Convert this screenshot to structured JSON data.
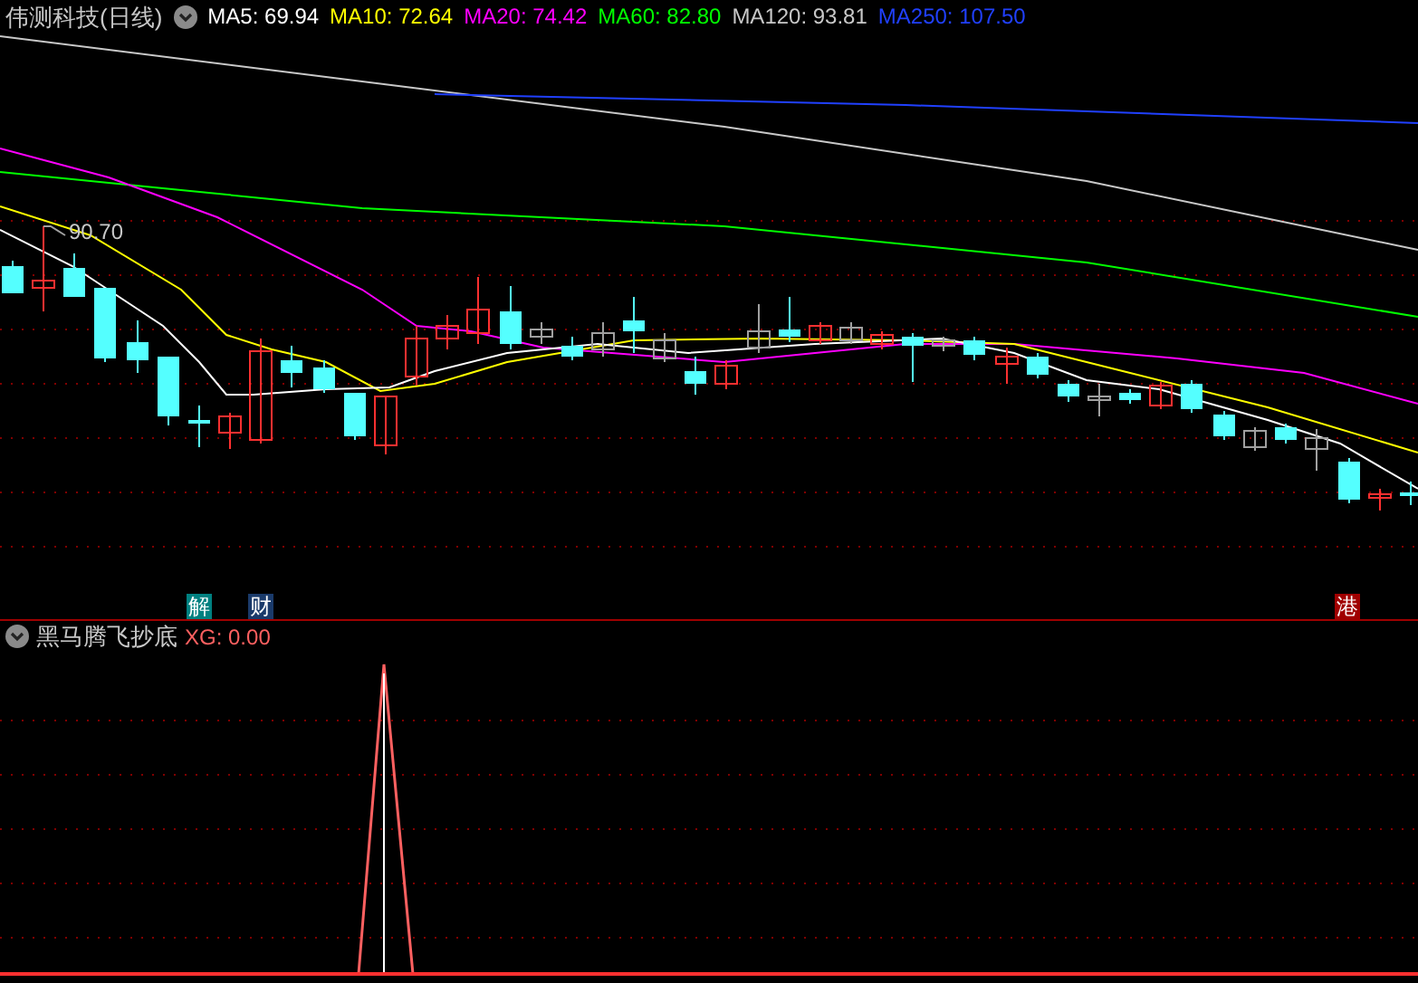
{
  "header": {
    "title": "伟测科技(日线)",
    "averages": [
      {
        "text": "MA5: 69.94",
        "color": "#ffffff"
      },
      {
        "text": "MA10: 72.64",
        "color": "#ffff00"
      },
      {
        "text": "MA20: 74.42",
        "color": "#ff00ff"
      },
      {
        "text": "MA60: 82.80",
        "color": "#00ff00"
      },
      {
        "text": "MA120: 93.81",
        "color": "#c8c8c8"
      },
      {
        "text": "MA250: 107.50",
        "color": "#2040ff"
      }
    ]
  },
  "price_marker": "90.70",
  "events": [
    {
      "text": "解",
      "color": "#008080"
    },
    {
      "text": "财",
      "color": "#1a3a6a"
    },
    {
      "text": "港",
      "color": "#a00000"
    }
  ],
  "indicator": {
    "name": "黑马腾飞抄底",
    "reading": "XG: 0.00"
  }
}
